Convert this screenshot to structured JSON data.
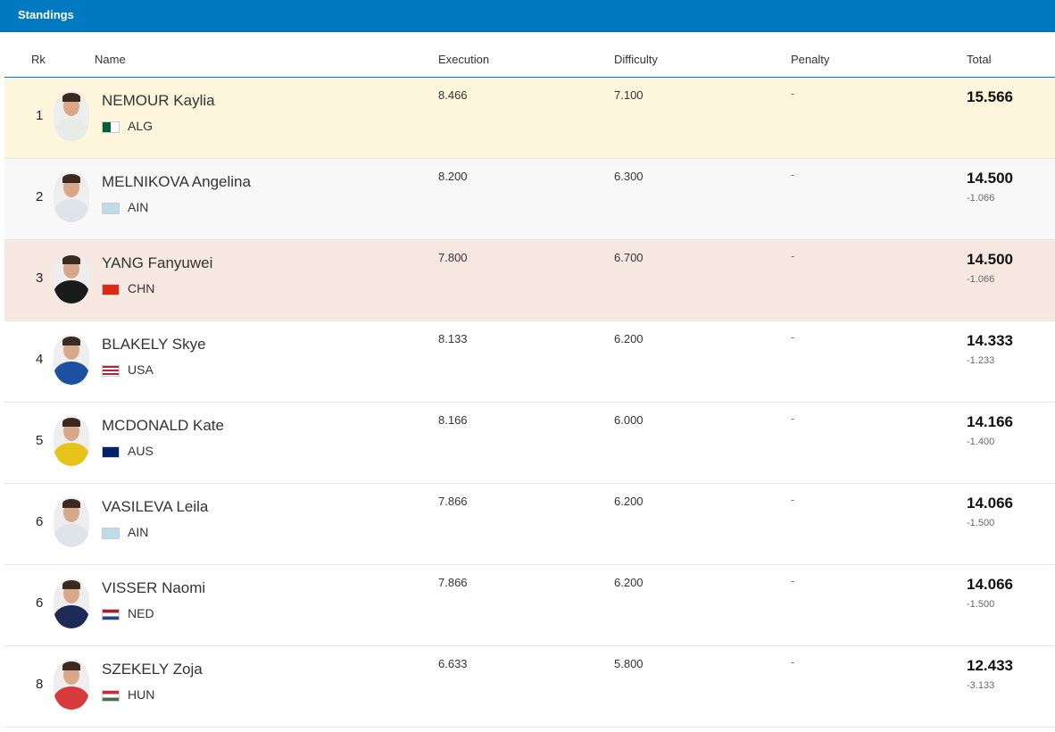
{
  "title": "Standings",
  "columns": {
    "rk": "Rk",
    "name": "Name",
    "execution": "Execution",
    "difficulty": "Difficulty",
    "penalty": "Penalty",
    "total": "Total"
  },
  "colors": {
    "header": "#0079c1",
    "gold": "#fdf5dc",
    "silver": "#f8f8f8",
    "bronze": "#f7e8e1"
  },
  "rows": [
    {
      "rk": "1",
      "name": "NEMOUR Kaylia",
      "country": "ALG",
      "execution": "8.466",
      "difficulty": "7.100",
      "penalty": "-",
      "total": "15.566",
      "gap": ""
    },
    {
      "rk": "2",
      "name": "MELNIKOVA Angelina",
      "country": "AIN",
      "execution": "8.200",
      "difficulty": "6.300",
      "penalty": "-",
      "total": "14.500",
      "gap": "-1.066"
    },
    {
      "rk": "3",
      "name": "YANG Fanyuwei",
      "country": "CHN",
      "execution": "7.800",
      "difficulty": "6.700",
      "penalty": "-",
      "total": "14.500",
      "gap": "-1.066"
    },
    {
      "rk": "4",
      "name": "BLAKELY Skye",
      "country": "USA",
      "execution": "8.133",
      "difficulty": "6.200",
      "penalty": "-",
      "total": "14.333",
      "gap": "-1.233"
    },
    {
      "rk": "5",
      "name": "MCDONALD Kate",
      "country": "AUS",
      "execution": "8.166",
      "difficulty": "6.000",
      "penalty": "-",
      "total": "14.166",
      "gap": "-1.400"
    },
    {
      "rk": "6",
      "name": "VASILEVA Leila",
      "country": "AIN",
      "execution": "7.866",
      "difficulty": "6.200",
      "penalty": "-",
      "total": "14.066",
      "gap": "-1.500"
    },
    {
      "rk": "6",
      "name": "VISSER Naomi",
      "country": "NED",
      "execution": "7.866",
      "difficulty": "6.200",
      "penalty": "-",
      "total": "14.066",
      "gap": "-1.500"
    },
    {
      "rk": "8",
      "name": "SZEKELY Zoja",
      "country": "HUN",
      "execution": "6.633",
      "difficulty": "5.800",
      "penalty": "-",
      "total": "12.433",
      "gap": "-3.133"
    }
  ]
}
